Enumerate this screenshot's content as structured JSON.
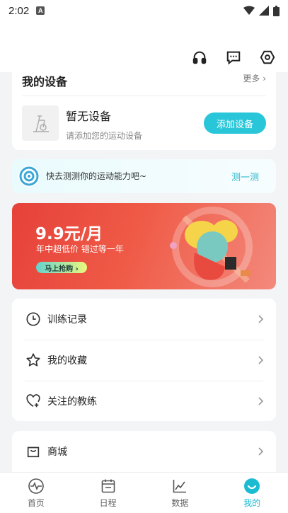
{
  "status_bar": {
    "time": "2:02",
    "badge": "A"
  },
  "devices": {
    "title": "我的设备",
    "more": "更多",
    "empty_title": "暂无设备",
    "empty_hint": "请添加您的运动设备",
    "add_button": "添加设备"
  },
  "test_prompt": {
    "text": "快去测测你的运动能力吧~",
    "action": "测一测"
  },
  "banner": {
    "price": "9.9元/月",
    "subtitle": "年中超低价  错过等一年",
    "button": "马上抢购 ›"
  },
  "menu": [
    {
      "label": "训练记录",
      "icon": "clock-icon"
    },
    {
      "label": "我的收藏",
      "icon": "star-icon"
    },
    {
      "label": "关注的教练",
      "icon": "heart-plus-icon"
    }
  ],
  "shop": {
    "label": "商城",
    "icon": "bag-icon"
  },
  "tabs": [
    {
      "label": "首页",
      "icon": "pulse-icon",
      "active": false
    },
    {
      "label": "日程",
      "icon": "calendar-icon",
      "active": false
    },
    {
      "label": "数据",
      "icon": "chart-icon",
      "active": false
    },
    {
      "label": "我的",
      "icon": "smile-icon",
      "active": true
    }
  ],
  "colors": {
    "accent": "#28c6d8",
    "banner_red": "#e6413a",
    "background": "#f3f4f6"
  }
}
